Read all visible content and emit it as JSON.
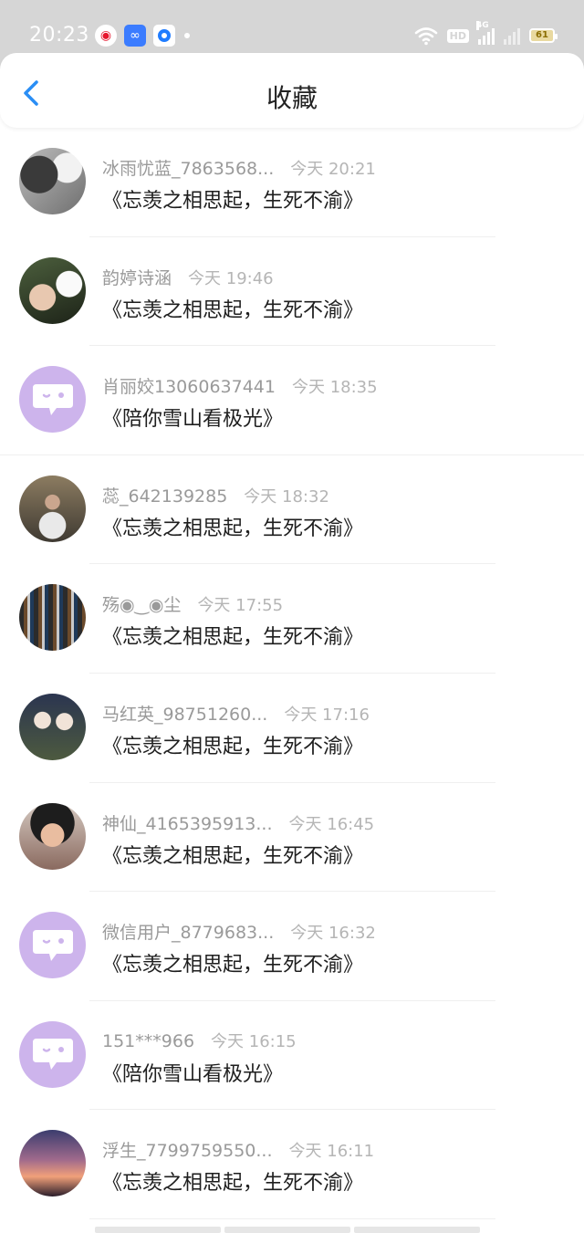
{
  "status_bar": {
    "time": "20:23",
    "apps": [
      "weibo-icon",
      "infinity-app-icon",
      "blue-ring-app-icon"
    ],
    "hd_label": "HD",
    "network_label": "4G",
    "battery": "61"
  },
  "header": {
    "title": "收藏",
    "back_icon": "chevron-left-icon"
  },
  "colors": {
    "accent": "#2a8ef5",
    "default_avatar": "#cdb4ec",
    "username": "#9a9a9a",
    "time": "#b5b5b5"
  },
  "favorites": [
    {
      "username": "冰雨忧蓝_7863568...",
      "time": "今天 20:21",
      "content": "《忘羡之相思起，生死不渝》",
      "avatar": "photo"
    },
    {
      "username": "韵婷诗涵",
      "time": "今天 19:46",
      "content": "《忘羡之相思起，生死不渝》",
      "avatar": "photo"
    },
    {
      "username": "肖丽姣13060637441",
      "time": "今天 18:35",
      "content": "《陪你雪山看极光》",
      "avatar": "default"
    },
    {
      "username": "蕊_642139285",
      "time": "今天 18:32",
      "content": "《忘羡之相思起，生死不渝》",
      "avatar": "photo"
    },
    {
      "username": "殇◉‿◉尘",
      "time": "今天 17:55",
      "content": "《忘羡之相思起，生死不渝》",
      "avatar": "photo"
    },
    {
      "username": "马红英_98751260...",
      "time": "今天 17:16",
      "content": "《忘羡之相思起，生死不渝》",
      "avatar": "photo"
    },
    {
      "username": "神仙_4165395913...",
      "time": "今天 16:45",
      "content": "《忘羡之相思起，生死不渝》",
      "avatar": "photo"
    },
    {
      "username": "微信用户_8779683...",
      "time": "今天 16:32",
      "content": "《忘羡之相思起，生死不渝》",
      "avatar": "default"
    },
    {
      "username": "151***966",
      "time": "今天 16:15",
      "content": "《陪你雪山看极光》",
      "avatar": "default"
    },
    {
      "username": "浮生_7799759550...",
      "time": "今天 16:11",
      "content": "《忘羡之相思起，生死不渝》",
      "avatar": "photo"
    }
  ]
}
